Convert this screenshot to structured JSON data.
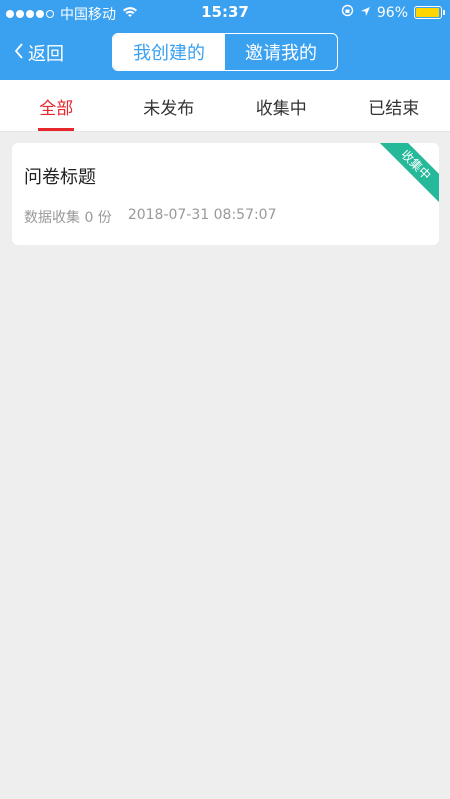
{
  "status_bar": {
    "carrier": "中国移动",
    "time": "15:37",
    "battery": "96%",
    "battery_level": 0.96
  },
  "nav": {
    "back_label": "返回",
    "segments": [
      {
        "label": "我创建的",
        "active": true
      },
      {
        "label": "邀请我的",
        "active": false
      }
    ]
  },
  "tabs": [
    {
      "label": "全部",
      "active": true
    },
    {
      "label": "未发布",
      "active": false
    },
    {
      "label": "收集中",
      "active": false
    },
    {
      "label": "已结束",
      "active": false
    }
  ],
  "surveys": [
    {
      "title": "问卷标题",
      "collected": "数据收集 0 份",
      "timestamp": "2018-07-31 08:57:07",
      "status_badge": "收集中"
    }
  ],
  "colors": {
    "header": "#3aa0f0",
    "tab_active": "#e8262d",
    "badge": "#25b99a",
    "background": "#eeeeee"
  }
}
